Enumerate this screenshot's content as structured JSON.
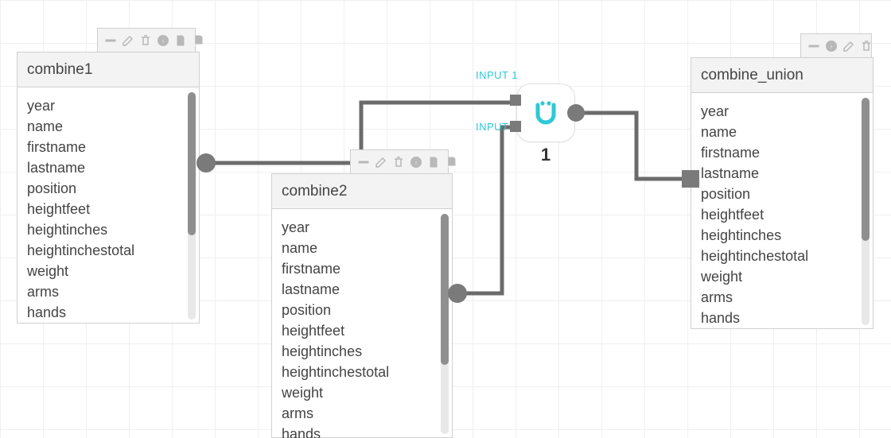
{
  "nodes": {
    "combine1": {
      "title": "combine1",
      "fields": [
        "year",
        "name",
        "firstname",
        "lastname",
        "position",
        "heightfeet",
        "heightinches",
        "heightinchestotal",
        "weight",
        "arms",
        "hands"
      ]
    },
    "combine2": {
      "title": "combine2",
      "fields": [
        "year",
        "name",
        "firstname",
        "lastname",
        "position",
        "heightfeet",
        "heightinches",
        "heightinchestotal",
        "weight",
        "arms",
        "hands"
      ]
    },
    "combine_union": {
      "title": "combine_union",
      "fields": [
        "year",
        "name",
        "firstname",
        "lastname",
        "position",
        "heightfeet",
        "heightinches",
        "heightinchestotal",
        "weight",
        "arms",
        "hands"
      ]
    }
  },
  "operator": {
    "count_label": "1",
    "input_labels": {
      "in1": "INPUT 1",
      "in2": "INPUT 2"
    }
  },
  "tab_icons": {
    "left": [
      "minimize-icon",
      "edit-icon",
      "trash-icon",
      "info-icon",
      "doc-icon",
      "copy-icon"
    ],
    "right": [
      "minimize-icon",
      "info-icon",
      "edit-icon",
      "trash-icon"
    ]
  },
  "colors": {
    "accent": "#2ec8d6",
    "wire": "#6b6b6b",
    "port": "#7a7a7a"
  }
}
